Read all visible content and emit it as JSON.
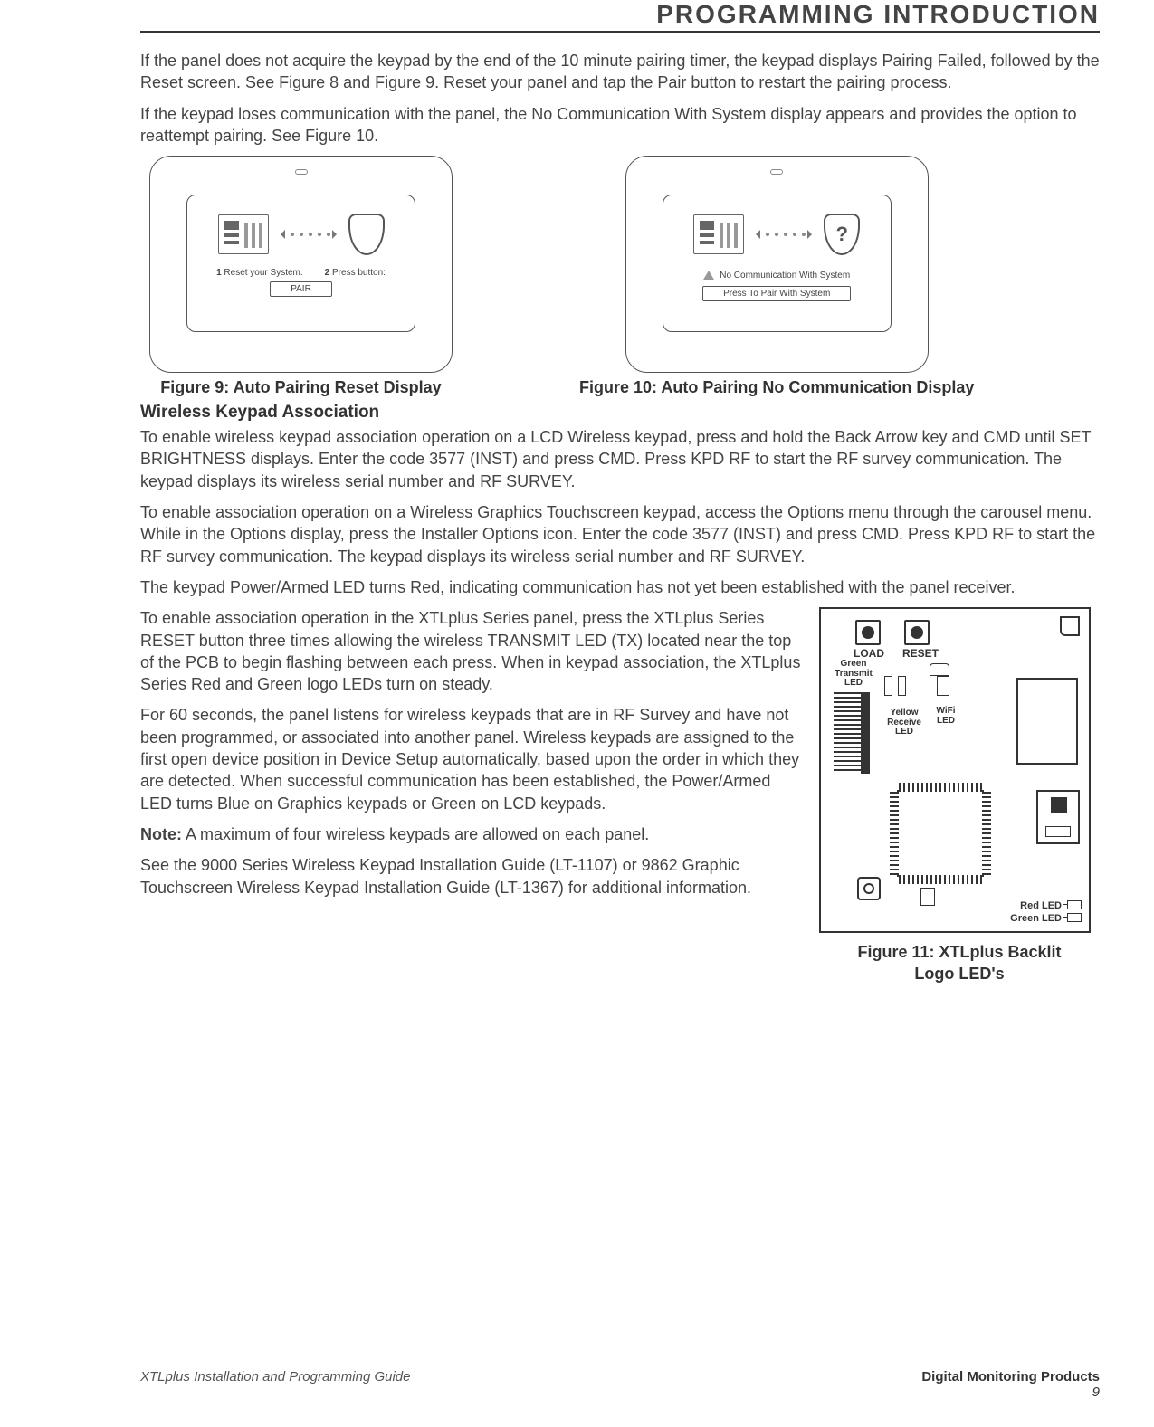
{
  "header": {
    "title": "PROGRAMMING INTRODUCTION"
  },
  "intro": {
    "p1": "If the panel does not acquire the keypad by the end of the 10 minute pairing timer, the keypad displays Pairing Failed, followed by the Reset screen. See Figure 8 and Figure 9. Reset your panel and tap the Pair button to restart the pairing process.",
    "p2": "If the keypad loses communication with the panel, the No Communication With System display appears and provides the option to reattempt pairing. See Figure 10."
  },
  "fig9": {
    "caption": "Figure 9: Auto Pairing Reset Display",
    "step1_num": "1",
    "step1": "Reset your System.",
    "step2_num": "2",
    "step2": "Press button:",
    "button": "PAIR"
  },
  "fig10": {
    "caption": "Figure 10: Auto Pairing No Communication Display",
    "line1": "No Communication With System",
    "button": "Press To Pair With System",
    "question": "?"
  },
  "wireless": {
    "heading": "Wireless Keypad Association",
    "p1": "To enable wireless keypad association operation on a LCD Wireless keypad, press and hold the Back Arrow key and CMD until SET BRIGHTNESS displays. Enter the code 3577 (INST) and press CMD. Press KPD RF to start the RF survey communication. The keypad displays its wireless serial number and RF SURVEY.",
    "p2": "To enable association operation on a Wireless Graphics Touchscreen keypad, access the Options menu through the carousel menu. While in the Options display, press the Installer Options icon. Enter the code 3577 (INST) and press CMD. Press KPD RF to start the RF survey communication. The keypad displays its wireless serial number and RF SURVEY.",
    "p3": "The keypad Power/Armed LED turns Red, indicating communication has not yet been established with the panel receiver.",
    "p4": "To enable association operation in the XTLplus Series panel, press the XTLplus Series RESET button three times allowing the wireless TRANSMIT LED (TX) located near the top of the PCB to begin flashing between each press. When in keypad association, the XTLplus Series Red and Green logo LEDs turn on steady.",
    "p5": "For 60 seconds, the panel listens for wireless keypads that are in RF Survey and have not been programmed, or associated into another panel. Wireless keypads are assigned to the first open device position in Device Setup automatically, based upon the order in which they are detected. When successful communication has been established, the Power/Armed LED turns Blue on Graphics keypads or Green on LCD keypads.",
    "note_label": "Note:",
    "note": " A maximum of four wireless keypads are allowed on each panel.",
    "p6": "See the 9000 Series Wireless Keypad Installation Guide (LT-1107) or 9862 Graphic Touchscreen Wireless Keypad Installation Guide (LT-1367) for additional information."
  },
  "fig11": {
    "caption_l1": "Figure 11: XTLplus Backlit",
    "caption_l2": "Logo LED's",
    "labels": {
      "load": "LOAD",
      "reset": "RESET",
      "green_tx": "Green Transmit LED",
      "yellow_rx": "Yellow Receive LED",
      "wifi": "WiFi LED",
      "red": "Red LED",
      "green": "Green LED"
    }
  },
  "footer": {
    "left": "XTLplus Installation and Programming Guide",
    "right": "Digital Monitoring Products",
    "page": "9"
  }
}
